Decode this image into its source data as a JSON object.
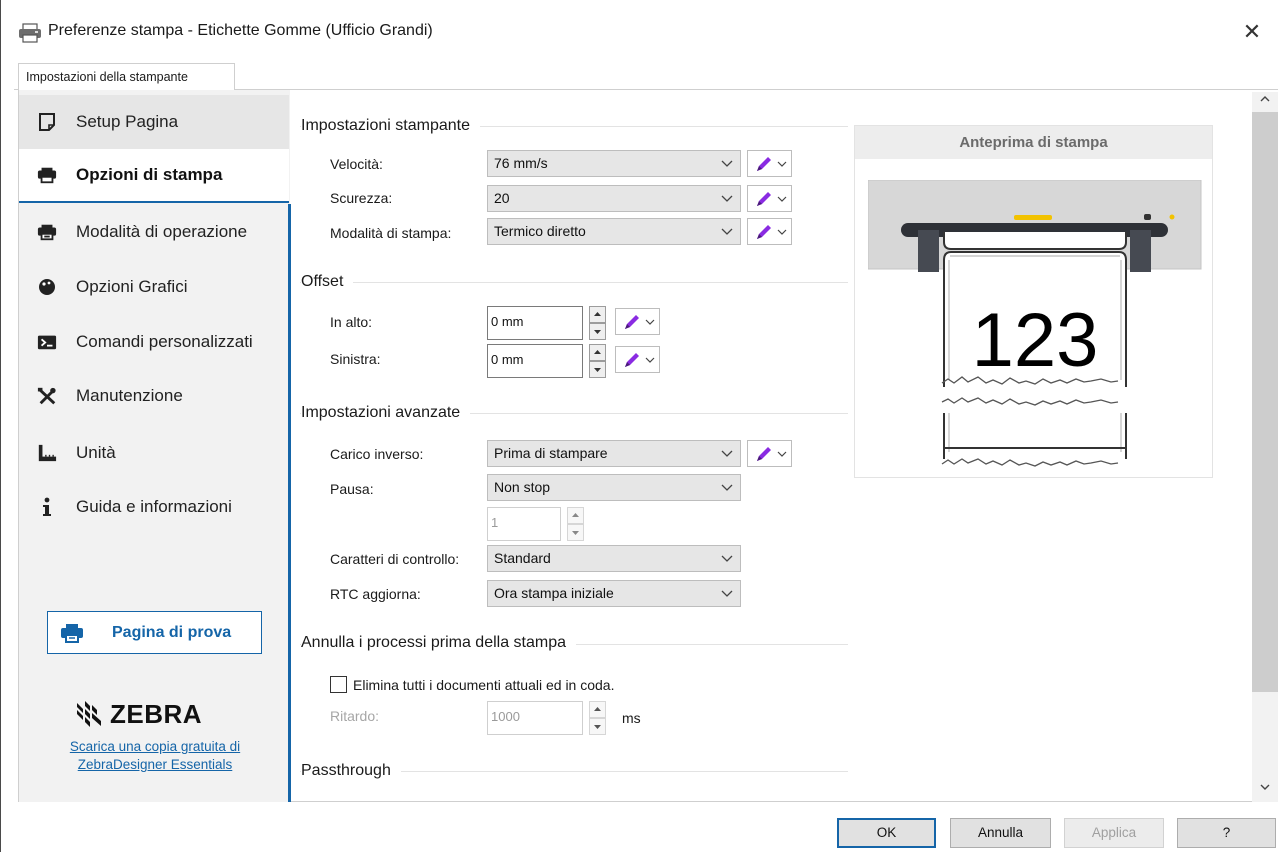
{
  "window": {
    "title": "Preferenze stampa - Etichette Gomme (Ufficio Grandi)",
    "close_glyph": "✕"
  },
  "tab": {
    "label": "Impostazioni della stampante"
  },
  "sidebar": {
    "items": [
      {
        "label": "Setup Pagina",
        "icon": "page-icon"
      },
      {
        "label": "Opzioni di stampa",
        "icon": "printer-icon"
      },
      {
        "label": "Modalità di operazione",
        "icon": "printer-mode-icon"
      },
      {
        "label": "Opzioni Grafici",
        "icon": "palette-icon"
      },
      {
        "label": "Comandi personalizzati",
        "icon": "terminal-icon"
      },
      {
        "label": "Manutenzione",
        "icon": "tools-icon"
      },
      {
        "label": "Unità",
        "icon": "ruler-icon"
      },
      {
        "label": "Guida e informazioni",
        "icon": "info-icon"
      }
    ],
    "test_page_label": "Pagina di prova",
    "brand": "ZEBRA",
    "download_link_line1": "Scarica una copia gratuita di",
    "download_link_line2": "ZebraDesigner Essentials"
  },
  "printer_settings": {
    "title": "Impostazioni stampante",
    "speed_label": "Velocità:",
    "speed_value": "76 mm/s",
    "darkness_label": "Scurezza:",
    "darkness_value": "20",
    "mode_label": "Modalità di stampa:",
    "mode_value": "Termico diretto"
  },
  "offset": {
    "title": "Offset",
    "top_label": "In alto:",
    "top_value": "0 mm",
    "left_label": "Sinistra:",
    "left_value": "0 mm"
  },
  "advanced": {
    "title": "Impostazioni avanzate",
    "backfeed_label": "Carico inverso:",
    "backfeed_value": "Prima di stampare",
    "pause_label": "Pausa:",
    "pause_value": "Non stop",
    "pause_count": "1",
    "control_chars_label": "Caratteri di controllo:",
    "control_chars_value": "Standard",
    "rtc_label": "RTC aggiorna:",
    "rtc_value": "Ora stampa iniziale"
  },
  "cancel_jobs": {
    "title": "Annulla i processi prima della stampa",
    "checkbox_label": "Elimina tutti i documenti attuali ed in coda.",
    "checkbox_checked": false,
    "delay_label": "Ritardo:",
    "delay_value": "1000",
    "delay_unit": "ms"
  },
  "passthrough": {
    "title": "Passthrough"
  },
  "preview": {
    "title": "Anteprima di stampa",
    "label_text": "123"
  },
  "buttons": {
    "ok": "OK",
    "cancel": "Annulla",
    "apply": "Applica",
    "help": "?"
  },
  "colors": {
    "accent": "#1565a8",
    "pen": "#8a2be2",
    "led": "#f2c200"
  }
}
